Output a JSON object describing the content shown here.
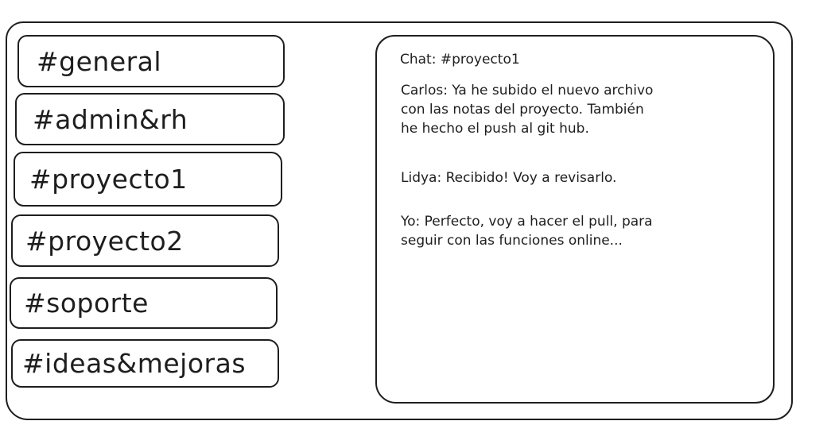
{
  "channels": [
    {
      "label": "#general"
    },
    {
      "label": "#admin&rh"
    },
    {
      "label": "#proyecto1"
    },
    {
      "label": "#proyecto2"
    },
    {
      "label": "#soporte"
    },
    {
      "label": "#ideas&mejoras"
    }
  ],
  "chat": {
    "title": "Chat: #proyecto1",
    "messages": [
      {
        "lines": [
          "Carlos: Ya he subido el nuevo archivo",
          "con las notas del proyecto. También",
          "he hecho el push al git hub."
        ]
      },
      {
        "lines": [
          "Lidya: Recibido! Voy a revisarlo."
        ]
      },
      {
        "lines": [
          "Yo: Perfecto, voy a hacer el pull, para",
          "seguir con las funciones online..."
        ]
      }
    ]
  }
}
